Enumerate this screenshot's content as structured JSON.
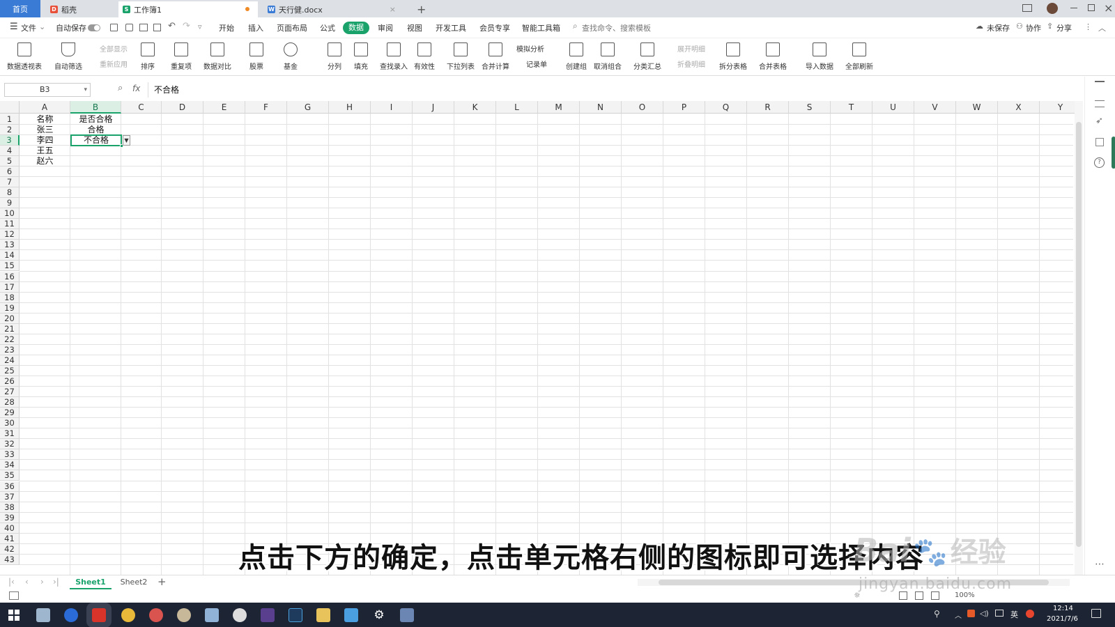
{
  "tabs": {
    "home": "首页",
    "docer": "稻壳",
    "workbook": "工作簿1",
    "doc": "天行健.docx",
    "new_tab": "+"
  },
  "menubar": {
    "file": "文件",
    "autosave": "自动保存",
    "menus": [
      "开始",
      "插入",
      "页面布局",
      "公式",
      "数据",
      "审阅",
      "视图",
      "开发工具",
      "会员专享",
      "智能工具箱"
    ],
    "active_menu": "数据",
    "search_placeholder": "查找命令、搜索模板",
    "unsaved": "未保存",
    "collab": "协作",
    "share": "分享"
  },
  "ribbon": {
    "pivot": "数据透视表",
    "autofilter": "自动筛选",
    "show_all": "全部显示",
    "reapply": "重新应用",
    "sort": "排序",
    "duplicates": "重复项",
    "compare": "数据对比",
    "stocks": "股票",
    "funds": "基金",
    "split_col": "分列",
    "fill": "填充",
    "lookup": "查找录入",
    "validity": "有效性",
    "dropdown_list": "下拉列表",
    "consolidate": "合并计算",
    "simulation": "模拟分析",
    "record": "记录单",
    "group": "创建组",
    "ungroup": "取消组合",
    "subtotal": "分类汇总",
    "expand_detail": "展开明细",
    "collapse_detail": "折叠明细",
    "split_table": "拆分表格",
    "merge_table": "合并表格",
    "import_data": "导入数据",
    "refresh_all": "全部刷新"
  },
  "formula_bar": {
    "name_box": "B3",
    "fx": "fx",
    "content": "不合格"
  },
  "sheet": {
    "columns": [
      "A",
      "B",
      "C",
      "D",
      "E",
      "F",
      "G",
      "H",
      "I",
      "J",
      "K",
      "L",
      "M",
      "N",
      "O",
      "P",
      "Q",
      "R",
      "S",
      "T",
      "U",
      "V",
      "W",
      "X",
      "Y"
    ],
    "rows": [
      "1",
      "2",
      "3",
      "4",
      "5",
      "6",
      "7",
      "8",
      "9",
      "10",
      "11",
      "12",
      "13",
      "14",
      "15",
      "16",
      "17",
      "18",
      "19",
      "20",
      "21",
      "22",
      "23",
      "24",
      "25",
      "26",
      "27",
      "28",
      "29",
      "30",
      "31",
      "32",
      "33",
      "34",
      "35",
      "36",
      "37",
      "38",
      "39",
      "40",
      "41",
      "42",
      "43"
    ],
    "col_a": [
      "名称",
      "张三",
      "李四",
      "王五",
      "赵六"
    ],
    "col_b": [
      "是否合格",
      "合格",
      "不合格"
    ],
    "selected_cell": "B3"
  },
  "sheet_tabs": {
    "sheet1": "Sheet1",
    "sheet2": "Sheet2",
    "add": "+"
  },
  "status": {
    "zoom": "100%"
  },
  "taskbar": {
    "time": "12:14",
    "date": "2021/7/6",
    "ime": "英"
  },
  "overlay": {
    "subtitle": "点击下方的确定，点击单元格右侧的图标即可选择内容",
    "watermark_brand": "Bai",
    "watermark_suffix": "经验",
    "watermark_url": "jingyan.baidu.com"
  },
  "colors": {
    "accent_green": "#1aa26b",
    "home_tab_blue": "#3a7bd5",
    "taskbar": "#1d2433"
  }
}
